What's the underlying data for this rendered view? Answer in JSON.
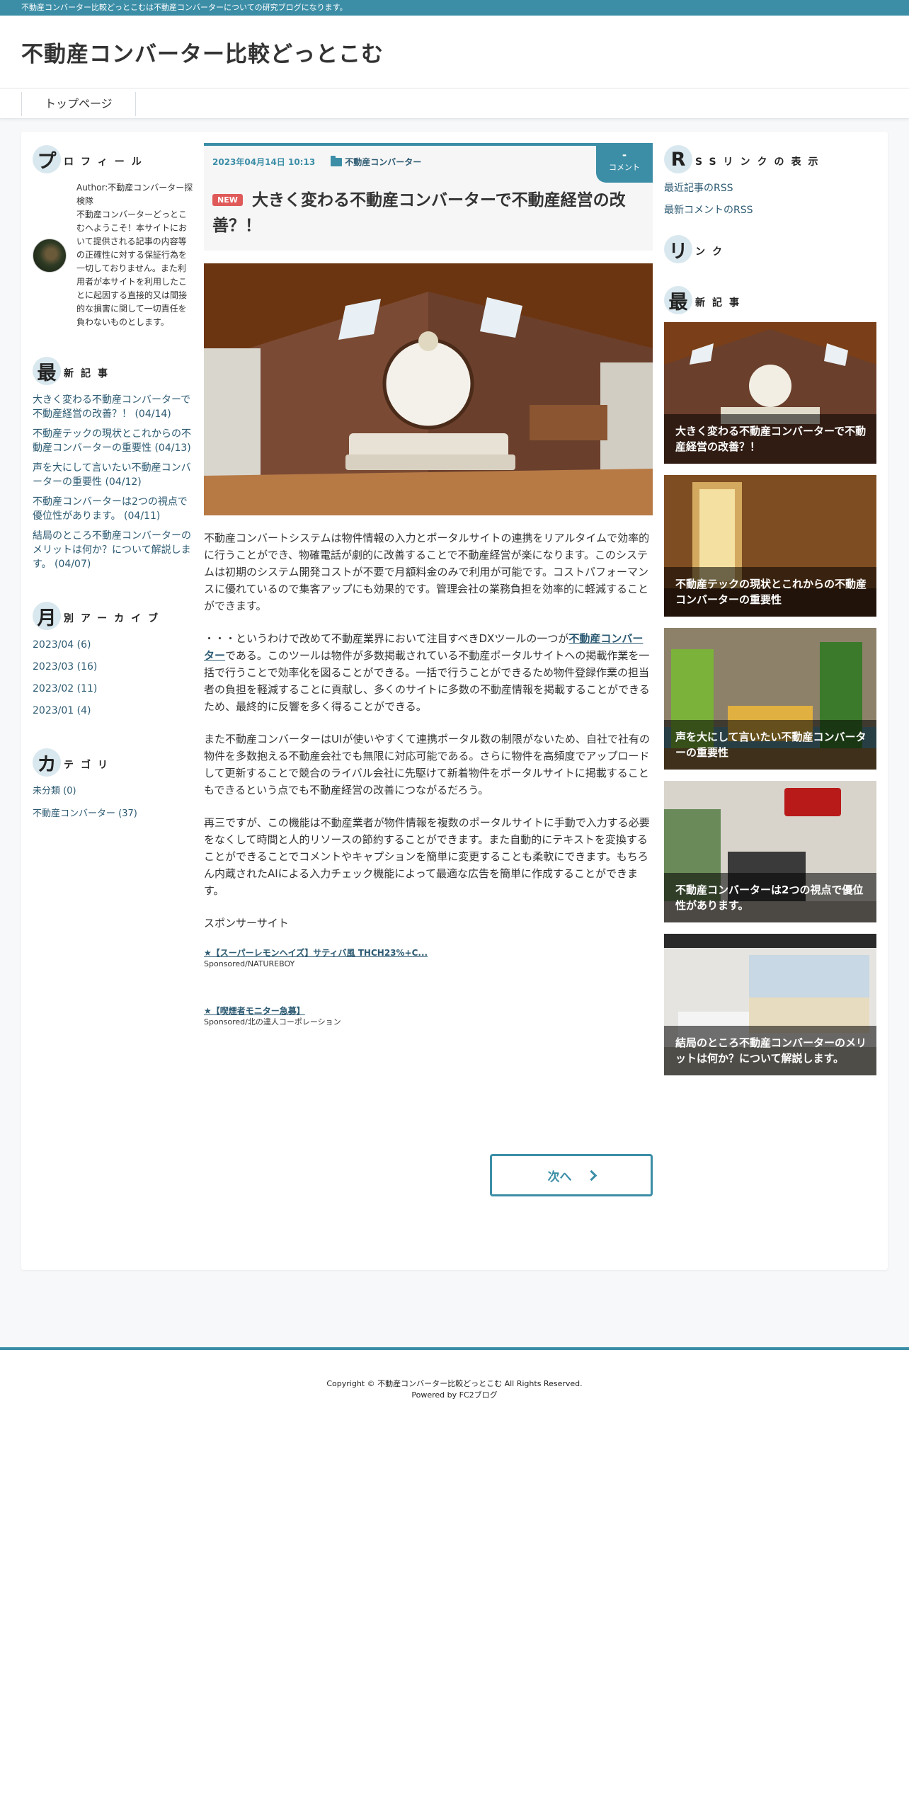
{
  "topbar": {
    "text": "不動産コンバーター比較どっとこむは不動産コンバーターについての研究ブログになります。"
  },
  "header": {
    "title": "不動産コンバーター比較どっとこむ"
  },
  "nav": {
    "items": [
      {
        "label": "トップページ"
      }
    ]
  },
  "left_sidebar": {
    "profile": {
      "title_first": "プ",
      "title_rest": "ロフィール",
      "text": "Author:不動産コンバーター探検隊\n不動産コンバーターどっとこむへようこそ！本サイトにおいて提供される記事の内容等の正確性に対する保証行為を一切しておりません。また利用者が本サイトを利用したことに起因する直接的又は間接的な損害に関して一切責任を負わないものとします。"
    },
    "recent": {
      "title_first": "最",
      "title_rest": "新記事",
      "items": [
        "大きく変わる不動産コンバーターで不動産経営の改善？！ (04/14)",
        "不動産テックの現状とこれからの不動産コンバーターの重要性 (04/13)",
        "声を大にして言いたい不動産コンバーターの重要性 (04/12)",
        "不動産コンバーターは2つの視点で優位性があります。 (04/11)",
        "結局のところ不動産コンバーターのメリットは何か？について解説します。 (04/07)"
      ]
    },
    "archive": {
      "title_first": "月",
      "title_rest": "別アーカイブ",
      "items": [
        "2023/04 (6)",
        "2023/03 (16)",
        "2023/02 (11)",
        "2023/01 (4)"
      ]
    },
    "category": {
      "title_first": "カ",
      "title_rest": "テゴリ",
      "items": [
        "未分類 (0)",
        "不動産コンバーター (37)"
      ]
    }
  },
  "post": {
    "date": "2023年04月14日 10:13",
    "category": "不動産コンバーター",
    "comment_count": "-",
    "comment_label": "コメント",
    "badge": "NEW",
    "title": "大きく変わる不動産コンバーターで不動産経営の改善？！",
    "p1": "不動産コンバートシステムは物件情報の入力とポータルサイトの連携をリアルタイムで効率的に行うことができ、物確電話が劇的に改善することで不動産経営が楽になります。このシステムは初期のシステム開発コストが不要で月額料金のみで利用が可能です。コストパフォーマンスに優れているので集客アップにも効果的です。管理会社の業務負担を効率的に軽減することができます。",
    "p2_before": "・・・というわけで改めて不動産業界において注目すべきDXツールの一つが",
    "p2_link": "不動産コンバーター",
    "p2_after": "である。このツールは物件が多数掲載されている不動産ポータルサイトへの掲載作業を一括で行うことで効率化を図ることができる。一括で行うことができるため物件登録作業の担当者の負担を軽減することに貢献し、多くのサイトに多数の不動産情報を掲載することができるため、最終的に反響を多く得ることができる。",
    "p3": "また不動産コンバーターはUIが使いやすくて連携ポータル数の制限がないため、自社で社有の物件を多数抱える不動産会社でも無限に対応可能である。さらに物件を高頻度でアップロードして更新することで競合のライバル会社に先駆けて新着物件をポータルサイトに掲載することもできるという点でも不動産経営の改善につながるだろう。",
    "p4": "再三ですが、この機能は不動産業者が物件情報を複数のポータルサイトに手動で入力する必要をなくして時間と人的リソースの節約することができます。また自動的にテキストを変換することができることでコメントやキャプションを簡単に変更することも柔軟にできます。もちろん内蔵されたAIによる入力チェック機能によって最適な広告を簡単に作成することができます。",
    "sponsor_heading": "スポンサーサイト",
    "ads": [
      {
        "link": "★【スーパーレモンヘイズ】サティバ風 THCH23%+C...",
        "source": "Sponsored/NATUREBOY"
      },
      {
        "link": "★【喫煙者モニター急募】",
        "source": "Sponsored/北の達人コーポレーション"
      }
    ],
    "next_label": "次へ"
  },
  "right_sidebar": {
    "rss": {
      "title_first": "R",
      "title_rest": "SSリンクの表示",
      "links": [
        "最近記事のRSS",
        "最新コメントのRSS"
      ]
    },
    "links": {
      "title_first": "リ",
      "title_rest": "ンク"
    },
    "recent": {
      "title_first": "最",
      "title_rest": "新記事",
      "cards": [
        "大きく変わる不動産コンバーターで不動産経営の改善？！",
        "不動産テックの現状とこれからの不動産コンバーターの重要性",
        "声を大にして言いたい不動産コンバーターの重要性",
        "不動産コンバーターは2つの視点で優位性があります。",
        "結局のところ不動産コンバーターのメリットは何か？について解説します。"
      ]
    }
  },
  "footer": {
    "copyright": "Copyright © 不動産コンバーター比較どっとこむ All Rights Reserved.",
    "powered": "Powered by FC2ブログ"
  },
  "colors": {
    "accent": "#3c8ea7",
    "badge": "#e05a5a",
    "link": "#2c5a72"
  }
}
